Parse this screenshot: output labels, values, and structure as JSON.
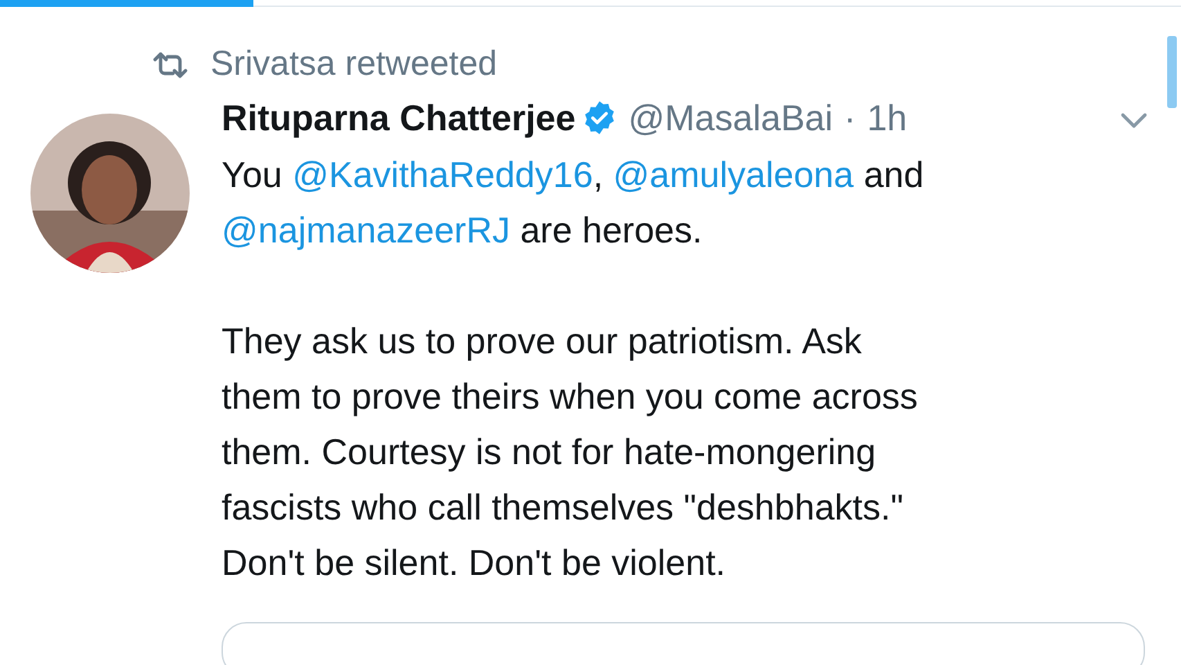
{
  "progress": {
    "level": 0.215
  },
  "retweet": {
    "text": "Srivatsa retweeted"
  },
  "tweet": {
    "name": "Rituparna Chatterjee",
    "verified": true,
    "handle": "@MasalaBai",
    "separator": "·",
    "time": "1h",
    "paragraphs": [
      [
        [
          {
            "kind": "plain",
            "text": "You "
          },
          {
            "kind": "mention",
            "text": "@KavithaReddy16"
          },
          {
            "kind": "plain",
            "text": ", "
          },
          {
            "kind": "mention",
            "text": "@amulyaleona"
          },
          {
            "kind": "plain",
            "text": " and"
          }
        ],
        [
          {
            "kind": "mention",
            "text": "@najmanazeerRJ"
          },
          {
            "kind": "plain",
            "text": " are heroes."
          }
        ]
      ],
      [
        [
          {
            "kind": "plain",
            "text": "They ask us to prove our patriotism. Ask"
          }
        ],
        [
          {
            "kind": "plain",
            "text": "them to prove theirs when you come across"
          }
        ],
        [
          {
            "kind": "plain",
            "text": "them. Courtesy is not for hate-mongering"
          }
        ],
        [
          {
            "kind": "plain",
            "text": "fascists who call themselves \"deshbhakts.\""
          }
        ],
        [
          {
            "kind": "plain",
            "text": "Don't be silent. Don't be violent."
          }
        ]
      ]
    ]
  }
}
